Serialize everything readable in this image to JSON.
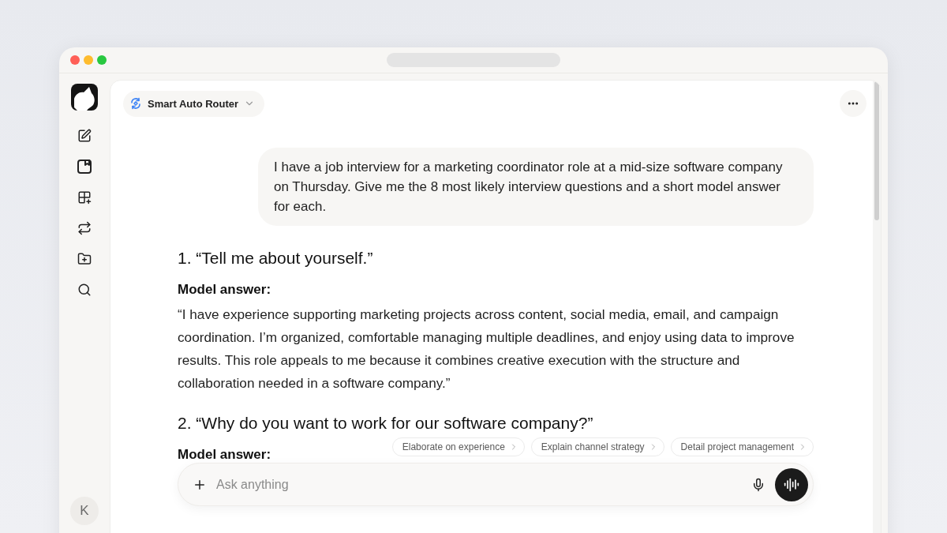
{
  "sidebar": {
    "avatar": {
      "initial": "K"
    }
  },
  "model_selector": {
    "label": "Smart Auto Router"
  },
  "conversation": [
    {
      "kind": "user",
      "text": "I have a job interview for a marketing coordinator role at a mid-size software company on Thursday. Give me the 8 most likely interview questions and a short model answer for each."
    },
    {
      "kind": "assistant",
      "blocks": [
        {
          "kind": "heading",
          "text": "1. “Tell me about yourself.”"
        },
        {
          "kind": "label",
          "text": "Model answer:"
        },
        {
          "kind": "paragraph",
          "text": "“I have experience supporting marketing projects across content, social media, email, and campaign coordination. I’m organized, comfortable managing multiple deadlines, and enjoy using data to improve results. This role appeals to me because it combines creative execution with the structure and collaboration needed in a software company.”"
        },
        {
          "kind": "heading",
          "text": "2. “Why do you want to work for our software company?”"
        },
        {
          "kind": "label",
          "text": "Model answer:"
        }
      ]
    }
  ],
  "suggestions": [
    "Elaborate on experience",
    "Explain channel strategy",
    "Detail project management"
  ],
  "composer": {
    "placeholder": "Ask anything"
  }
}
